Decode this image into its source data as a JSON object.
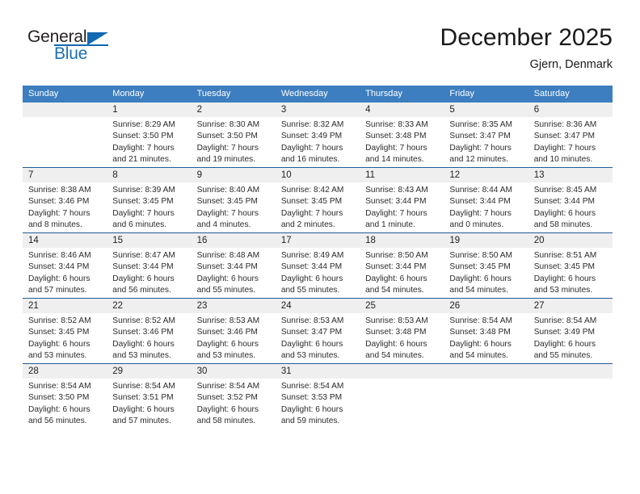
{
  "logo": {
    "word_general": "General",
    "word_blue": "Blue",
    "brand_color": "#1268b3",
    "icon": "triangle-flag-icon"
  },
  "header": {
    "title": "December 2025",
    "subtitle": "Gjern, Denmark"
  },
  "colors": {
    "header_band": "#3c7ebf",
    "row_divider": "#1f5c99",
    "daynum_band": "#efefef",
    "text": "#2b2b2b"
  },
  "calendar": {
    "weekday_headers": [
      "Sunday",
      "Monday",
      "Tuesday",
      "Wednesday",
      "Thursday",
      "Friday",
      "Saturday"
    ],
    "weeks": [
      [
        {
          "day": "",
          "lines": []
        },
        {
          "day": "1",
          "lines": [
            "Sunrise: 8:29 AM",
            "Sunset: 3:50 PM",
            "Daylight: 7 hours",
            "and 21 minutes."
          ]
        },
        {
          "day": "2",
          "lines": [
            "Sunrise: 8:30 AM",
            "Sunset: 3:50 PM",
            "Daylight: 7 hours",
            "and 19 minutes."
          ]
        },
        {
          "day": "3",
          "lines": [
            "Sunrise: 8:32 AM",
            "Sunset: 3:49 PM",
            "Daylight: 7 hours",
            "and 16 minutes."
          ]
        },
        {
          "day": "4",
          "lines": [
            "Sunrise: 8:33 AM",
            "Sunset: 3:48 PM",
            "Daylight: 7 hours",
            "and 14 minutes."
          ]
        },
        {
          "day": "5",
          "lines": [
            "Sunrise: 8:35 AM",
            "Sunset: 3:47 PM",
            "Daylight: 7 hours",
            "and 12 minutes."
          ]
        },
        {
          "day": "6",
          "lines": [
            "Sunrise: 8:36 AM",
            "Sunset: 3:47 PM",
            "Daylight: 7 hours",
            "and 10 minutes."
          ]
        }
      ],
      [
        {
          "day": "7",
          "lines": [
            "Sunrise: 8:38 AM",
            "Sunset: 3:46 PM",
            "Daylight: 7 hours",
            "and 8 minutes."
          ]
        },
        {
          "day": "8",
          "lines": [
            "Sunrise: 8:39 AM",
            "Sunset: 3:45 PM",
            "Daylight: 7 hours",
            "and 6 minutes."
          ]
        },
        {
          "day": "9",
          "lines": [
            "Sunrise: 8:40 AM",
            "Sunset: 3:45 PM",
            "Daylight: 7 hours",
            "and 4 minutes."
          ]
        },
        {
          "day": "10",
          "lines": [
            "Sunrise: 8:42 AM",
            "Sunset: 3:45 PM",
            "Daylight: 7 hours",
            "and 2 minutes."
          ]
        },
        {
          "day": "11",
          "lines": [
            "Sunrise: 8:43 AM",
            "Sunset: 3:44 PM",
            "Daylight: 7 hours",
            "and 1 minute."
          ]
        },
        {
          "day": "12",
          "lines": [
            "Sunrise: 8:44 AM",
            "Sunset: 3:44 PM",
            "Daylight: 7 hours",
            "and 0 minutes."
          ]
        },
        {
          "day": "13",
          "lines": [
            "Sunrise: 8:45 AM",
            "Sunset: 3:44 PM",
            "Daylight: 6 hours",
            "and 58 minutes."
          ]
        }
      ],
      [
        {
          "day": "14",
          "lines": [
            "Sunrise: 8:46 AM",
            "Sunset: 3:44 PM",
            "Daylight: 6 hours",
            "and 57 minutes."
          ]
        },
        {
          "day": "15",
          "lines": [
            "Sunrise: 8:47 AM",
            "Sunset: 3:44 PM",
            "Daylight: 6 hours",
            "and 56 minutes."
          ]
        },
        {
          "day": "16",
          "lines": [
            "Sunrise: 8:48 AM",
            "Sunset: 3:44 PM",
            "Daylight: 6 hours",
            "and 55 minutes."
          ]
        },
        {
          "day": "17",
          "lines": [
            "Sunrise: 8:49 AM",
            "Sunset: 3:44 PM",
            "Daylight: 6 hours",
            "and 55 minutes."
          ]
        },
        {
          "day": "18",
          "lines": [
            "Sunrise: 8:50 AM",
            "Sunset: 3:44 PM",
            "Daylight: 6 hours",
            "and 54 minutes."
          ]
        },
        {
          "day": "19",
          "lines": [
            "Sunrise: 8:50 AM",
            "Sunset: 3:45 PM",
            "Daylight: 6 hours",
            "and 54 minutes."
          ]
        },
        {
          "day": "20",
          "lines": [
            "Sunrise: 8:51 AM",
            "Sunset: 3:45 PM",
            "Daylight: 6 hours",
            "and 53 minutes."
          ]
        }
      ],
      [
        {
          "day": "21",
          "lines": [
            "Sunrise: 8:52 AM",
            "Sunset: 3:45 PM",
            "Daylight: 6 hours",
            "and 53 minutes."
          ]
        },
        {
          "day": "22",
          "lines": [
            "Sunrise: 8:52 AM",
            "Sunset: 3:46 PM",
            "Daylight: 6 hours",
            "and 53 minutes."
          ]
        },
        {
          "day": "23",
          "lines": [
            "Sunrise: 8:53 AM",
            "Sunset: 3:46 PM",
            "Daylight: 6 hours",
            "and 53 minutes."
          ]
        },
        {
          "day": "24",
          "lines": [
            "Sunrise: 8:53 AM",
            "Sunset: 3:47 PM",
            "Daylight: 6 hours",
            "and 53 minutes."
          ]
        },
        {
          "day": "25",
          "lines": [
            "Sunrise: 8:53 AM",
            "Sunset: 3:48 PM",
            "Daylight: 6 hours",
            "and 54 minutes."
          ]
        },
        {
          "day": "26",
          "lines": [
            "Sunrise: 8:54 AM",
            "Sunset: 3:48 PM",
            "Daylight: 6 hours",
            "and 54 minutes."
          ]
        },
        {
          "day": "27",
          "lines": [
            "Sunrise: 8:54 AM",
            "Sunset: 3:49 PM",
            "Daylight: 6 hours",
            "and 55 minutes."
          ]
        }
      ],
      [
        {
          "day": "28",
          "lines": [
            "Sunrise: 8:54 AM",
            "Sunset: 3:50 PM",
            "Daylight: 6 hours",
            "and 56 minutes."
          ]
        },
        {
          "day": "29",
          "lines": [
            "Sunrise: 8:54 AM",
            "Sunset: 3:51 PM",
            "Daylight: 6 hours",
            "and 57 minutes."
          ]
        },
        {
          "day": "30",
          "lines": [
            "Sunrise: 8:54 AM",
            "Sunset: 3:52 PM",
            "Daylight: 6 hours",
            "and 58 minutes."
          ]
        },
        {
          "day": "31",
          "lines": [
            "Sunrise: 8:54 AM",
            "Sunset: 3:53 PM",
            "Daylight: 6 hours",
            "and 59 minutes."
          ]
        },
        {
          "day": "",
          "lines": []
        },
        {
          "day": "",
          "lines": []
        },
        {
          "day": "",
          "lines": []
        }
      ]
    ]
  }
}
